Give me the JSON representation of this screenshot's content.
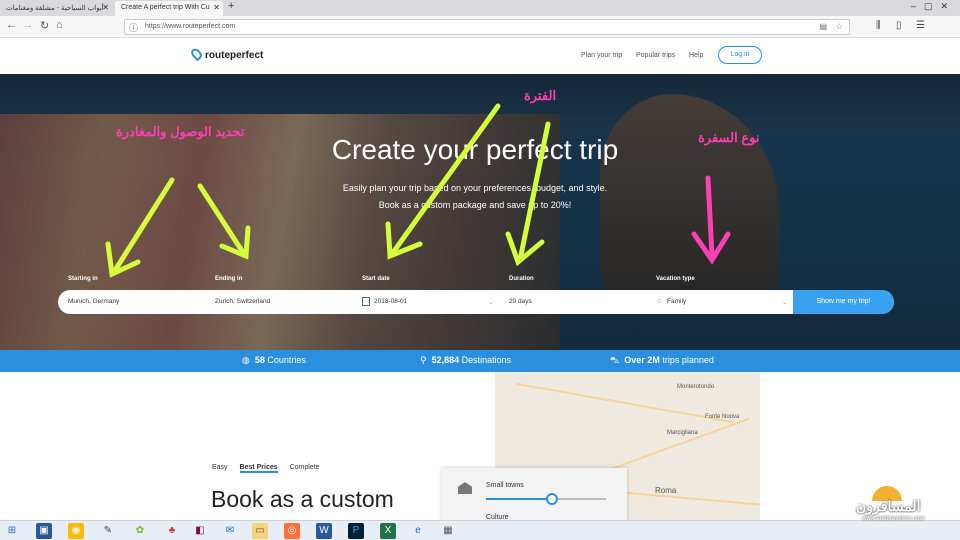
{
  "browser": {
    "tabs": [
      {
        "label": "أبواب السياحية - مشلقة ومغتامات"
      },
      {
        "label": "Create A perfect trip With Cu"
      }
    ],
    "new_tab": "+",
    "url": "https://www.routeperfect.com"
  },
  "site": {
    "logo": "routeperfect",
    "nav": [
      "Plan your trip",
      "Popular trips",
      "Help"
    ],
    "login": "Log in"
  },
  "hero": {
    "title": "Create your perfect trip",
    "subtitle1": "Easily plan your trip based on your preferences, budget, and style.",
    "subtitle2": "Book as a custom package and save up to 20%!",
    "fields": [
      {
        "label": "Starting in",
        "value": "Munich, Germany"
      },
      {
        "label": "Ending in",
        "value": "Zurich, Switzerland"
      },
      {
        "label": "Start date",
        "value": "2018-08-01"
      },
      {
        "label": "Duration",
        "value": "20 days"
      },
      {
        "label": "Vacation type",
        "value": "Family"
      }
    ],
    "submit": "Show me my trip!"
  },
  "annotations": {
    "arrival_departure": "تحديد الوصول والمغادرة",
    "period": "الفترة",
    "trip_type": "نوع السفرة"
  },
  "stats": [
    {
      "value": "58",
      "label": "Countries"
    },
    {
      "value": "52,884",
      "label": "Destinations"
    },
    {
      "value": "Over 2M",
      "label": "trips planned"
    }
  ],
  "lower": {
    "tabs": [
      "Easy",
      "Best Prices",
      "Complete"
    ],
    "selected_tab": "Best Prices",
    "heading": "Book as a custom",
    "panel": {
      "slider_label": "Small towns",
      "slider_level": 0.55,
      "second_label": "Culture"
    },
    "map_labels": [
      "Monterotondo",
      "Fonte Nuova",
      "Marcigliana",
      "Roma"
    ]
  },
  "watermark": {
    "text": "المسافرون",
    "url": "www.arabtravelers.com"
  },
  "colors": {
    "brand": "#2b8fe0",
    "annotation": "#ff3fb4",
    "arrow": "#d4ff3a"
  }
}
